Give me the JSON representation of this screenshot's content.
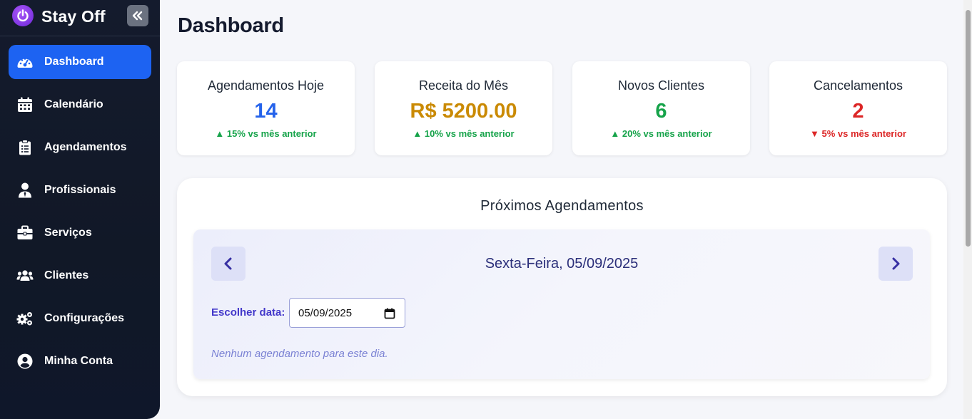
{
  "brand": {
    "name": "Stay Off",
    "logo_icon": "power-icon",
    "collapse_icon": "double-chevron-left-icon"
  },
  "sidebar": {
    "items": [
      {
        "label": "Dashboard",
        "icon": "gauge-icon",
        "active": true
      },
      {
        "label": "Calendário",
        "icon": "calendar-icon",
        "active": false
      },
      {
        "label": "Agendamentos",
        "icon": "clipboard-icon",
        "active": false
      },
      {
        "label": "Profissionais",
        "icon": "user-tie-icon",
        "active": false
      },
      {
        "label": "Serviços",
        "icon": "briefcase-icon",
        "active": false
      },
      {
        "label": "Clientes",
        "icon": "users-icon",
        "active": false
      },
      {
        "label": "Configurações",
        "icon": "gears-icon",
        "active": false
      },
      {
        "label": "Minha Conta",
        "icon": "user-circle-icon",
        "active": false
      }
    ]
  },
  "page": {
    "title": "Dashboard"
  },
  "stats": [
    {
      "title": "Agendamentos Hoje",
      "value": "14",
      "trend": "▲ 15% vs mês anterior",
      "value_color": "#2563eb",
      "trend_color": "#16a34a"
    },
    {
      "title": "Receita do Mês",
      "value": "R$ 5200.00",
      "trend": "▲ 10% vs mês anterior",
      "value_color": "#ca8a04",
      "trend_color": "#16a34a"
    },
    {
      "title": "Novos Clientes",
      "value": "6",
      "trend": "▲ 20% vs mês anterior",
      "value_color": "#16a34a",
      "trend_color": "#16a34a"
    },
    {
      "title": "Cancelamentos",
      "value": "2",
      "trend": "▼ 5% vs mês anterior",
      "value_color": "#dc2626",
      "trend_color": "#dc2626"
    }
  ],
  "appointments": {
    "title": "Próximos Agendamentos",
    "date_label": "Sexta-Feira, 05/09/2025",
    "pick_label": "Escolher data:",
    "date_value": "05/09/2025",
    "empty_message": "Nenhum agendamento para este dia."
  },
  "colors": {
    "accent": "#1d63f2",
    "sidebar_bg": "#111827"
  }
}
